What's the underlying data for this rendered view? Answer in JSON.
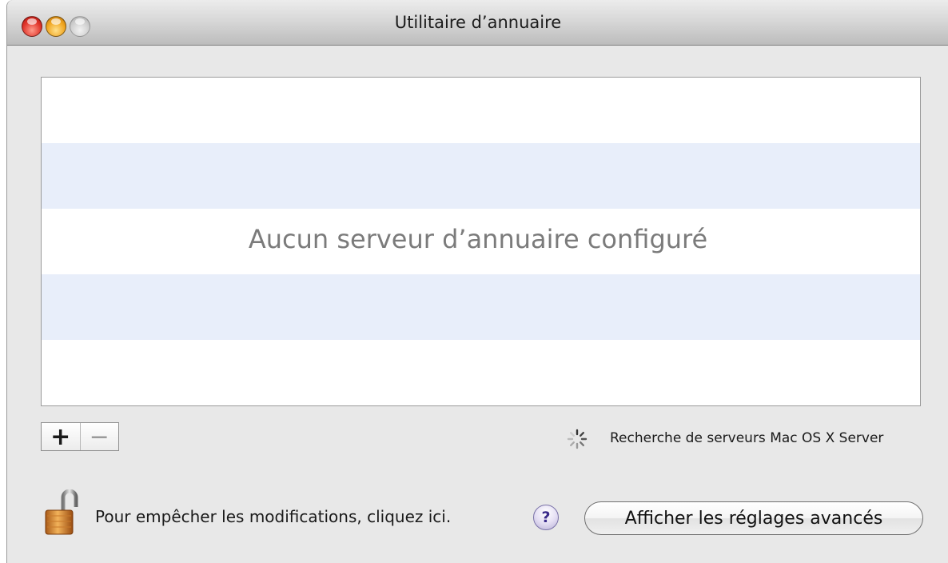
{
  "window": {
    "title": "Utilitaire d’annuaire"
  },
  "server_list": {
    "empty_message": "Aucun serveur d’annuaire configuré"
  },
  "list_controls": {
    "add_label": "+",
    "remove_label": "−"
  },
  "status": {
    "search_text": "Recherche de serveurs Mac OS X Server"
  },
  "footer": {
    "lock_text": "Pour empêcher les modifications, cliquez ici.",
    "help_label": "?",
    "advanced_button_label": "Afficher les réglages avancés"
  },
  "icons": [
    "close-icon",
    "minimize-icon",
    "zoom-icon",
    "spinner-icon",
    "unlocked-padlock-icon",
    "help-icon"
  ],
  "colors": {
    "window_bg": "#e8e8e8",
    "alt_row": "#e8eefa",
    "placeholder_text": "#7b7b7b"
  }
}
